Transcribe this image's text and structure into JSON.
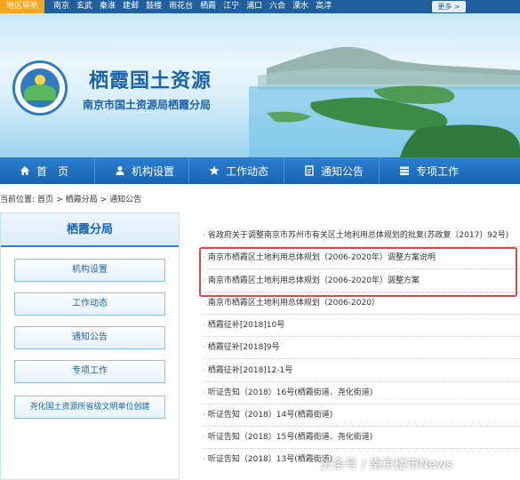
{
  "topnav": {
    "label": "地区导航",
    "districts": [
      "南京",
      "玄武",
      "秦淮",
      "建邺",
      "鼓楼",
      "雨花台",
      "栖霞",
      "江宁",
      "浦口",
      "六合",
      "溧水",
      "高淳"
    ],
    "more": "更多 >"
  },
  "banner": {
    "title": "栖霞国土资源",
    "subtitle": "南京市国土资源局栖霞分局"
  },
  "mainnav": {
    "items": [
      {
        "label": "首　页",
        "icon": "home-icon"
      },
      {
        "label": "机构设置",
        "icon": "user-icon"
      },
      {
        "label": "工作动态",
        "icon": "star-icon"
      },
      {
        "label": "通知公告",
        "icon": "document-icon"
      },
      {
        "label": "专项工作",
        "icon": "list-icon"
      }
    ]
  },
  "breadcrumb": {
    "prefix": "当前位置:",
    "items": [
      "首页",
      ">",
      "栖霞分局",
      ">",
      "通知公告"
    ]
  },
  "sidebar": {
    "title": "栖霞分局",
    "items": [
      "机构设置",
      "工作动态",
      "通知公告",
      "专项工作",
      "尧化国土资源所省级文明单位创建"
    ]
  },
  "list": {
    "items": [
      "省政府关于调整南京市苏州市有关区土地利用总体规划的批复(苏政复〔2017〕92号)",
      "南京市栖霞区土地利用总体规划（2006-2020年）调整方案说明",
      "南京市栖霞区土地利用总体规划（2006-2020年）调整方案",
      "南京市栖霞区土地利用总体规划（2006-2020）",
      "栖霞征补[2018]10号",
      "栖霞征补[2018]9号",
      "栖霞征补[2018]12-1号",
      "听证告知（2018）16号(栖霞街道、尧化街道)",
      "听证告知（2018）14号(栖霞街道)",
      "听证告知（2018）15号(栖霞街道、尧化街道)",
      "听证告知（2018）13号(栖霞街道)"
    ]
  },
  "watermark": "头条号 / 南京楼市News",
  "colors": {
    "primary": "#1f5f9e",
    "nav": "#2d7fd1",
    "highlight": "#e04848"
  }
}
